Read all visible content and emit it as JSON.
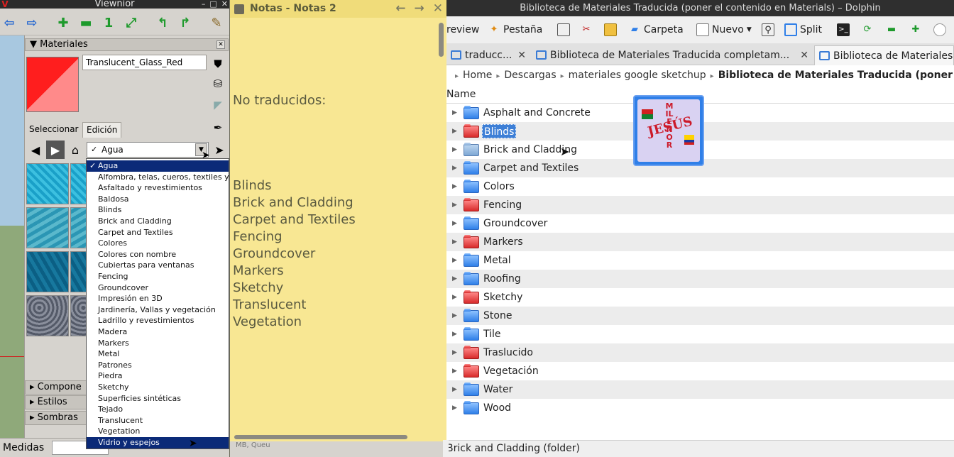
{
  "sketchup": {
    "window_title": "Viewnior",
    "logo": "V",
    "materials_header": "Materiales",
    "material_name": "Translucent_Glass_Red",
    "swatch_color": "#ff1e1e",
    "tabs": [
      "Seleccionar",
      "Edición"
    ],
    "library_selected": "Agua",
    "dropdown_items": [
      "Agua",
      "Alfombra, telas, cueros, textiles y",
      "Asfaltado y revestimientos",
      "Baldosa",
      "Blinds",
      "Brick and Cladding",
      "Carpet and Textiles",
      "Colores",
      "Colores con nombre",
      "Cubiertas para ventanas",
      "Fencing",
      "Groundcover",
      "Impresión en 3D",
      "Jardinería, Vallas y vegetación",
      "Ladrillo y revestimientos",
      "Madera",
      "Markers",
      "Metal",
      "Patrones",
      "Piedra",
      "Sketchy",
      "Superficies sintéticas",
      "Tejado",
      "Translucent",
      "Vegetation",
      "Vidrio y espejos"
    ],
    "accordion": [
      "Compone",
      "Estilos",
      "Sombras"
    ],
    "status_label": "Medidas"
  },
  "notes": {
    "title": "Notas - Notas 2",
    "heading": "No traducidos:",
    "items": [
      "Blinds",
      "Brick and Cladding",
      "Carpet and Textiles",
      "Fencing",
      "Groundcover",
      "Markers",
      "Sketchy",
      "Translucent",
      "Vegetation"
    ],
    "footer_fragment": "MB, Queu"
  },
  "dolphin": {
    "window_title": "Biblioteca de Materiales Traducida (poner el contenido en Materials) – Dolphin",
    "toolbar": {
      "preview": "review",
      "tab": "Pestaña",
      "folder": "Carpeta",
      "new": "Nuevo",
      "split": "Split"
    },
    "tabs": [
      "traducc...",
      "Biblioteca de Materiales Traducida completam...",
      "Biblioteca de Materiales"
    ],
    "breadcrumb": [
      "Home",
      "Descargas",
      "materiales google sketchup",
      "Biblioteca de Materiales Traducida (poner el contenido en Materials)"
    ],
    "column_name": "Name",
    "files": [
      {
        "name": "Asphalt and Concrete",
        "color": "blue"
      },
      {
        "name": "Blinds",
        "color": "red"
      },
      {
        "name": "Brick and Cladding",
        "color": "plus"
      },
      {
        "name": "Carpet and Textiles",
        "color": "blue"
      },
      {
        "name": "Colors",
        "color": "blue"
      },
      {
        "name": "Fencing",
        "color": "red"
      },
      {
        "name": "Groundcover",
        "color": "blue"
      },
      {
        "name": "Markers",
        "color": "red"
      },
      {
        "name": "Metal",
        "color": "blue"
      },
      {
        "name": "Roofing",
        "color": "blue"
      },
      {
        "name": "Sketchy",
        "color": "red"
      },
      {
        "name": "Stone",
        "color": "blue"
      },
      {
        "name": "Tile",
        "color": "blue"
      },
      {
        "name": "Traslucido",
        "color": "red"
      },
      {
        "name": "Vegetación",
        "color": "red"
      },
      {
        "name": "Water",
        "color": "blue"
      },
      {
        "name": "Wood",
        "color": "blue"
      }
    ],
    "preview_text": "JESÚS",
    "preview_vertical": "MILENOR",
    "status": "Brick and Cladding (folder)"
  }
}
